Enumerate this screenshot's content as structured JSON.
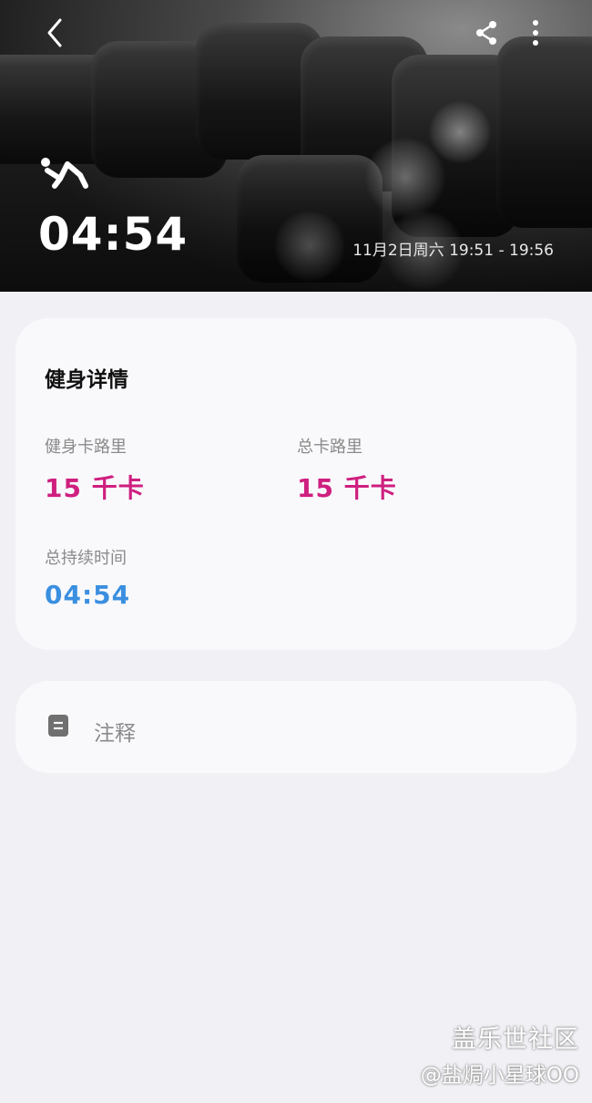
{
  "header": {
    "duration": "04:54",
    "date_range": "11月2日周六 19:51 - 19:56",
    "icons": [
      "back-icon",
      "share-icon",
      "more-vertical-icon",
      "workout-icon"
    ]
  },
  "details": {
    "title": "健身详情",
    "fitness_calories": {
      "label": "健身卡路里",
      "value": "15 千卡"
    },
    "total_calories": {
      "label": "总卡路里",
      "value": "15 千卡"
    },
    "total_duration": {
      "label": "总持续时间",
      "value": "04:54"
    }
  },
  "notes": {
    "label": "注释"
  },
  "watermark": {
    "line1": "盖乐世社区",
    "line2": "@盐焗小星球OO"
  },
  "colors": {
    "calorie": "#cf1f7f",
    "duration": "#3b8fe0",
    "background": "#f0f0f5",
    "card": "#f9f9fc"
  }
}
